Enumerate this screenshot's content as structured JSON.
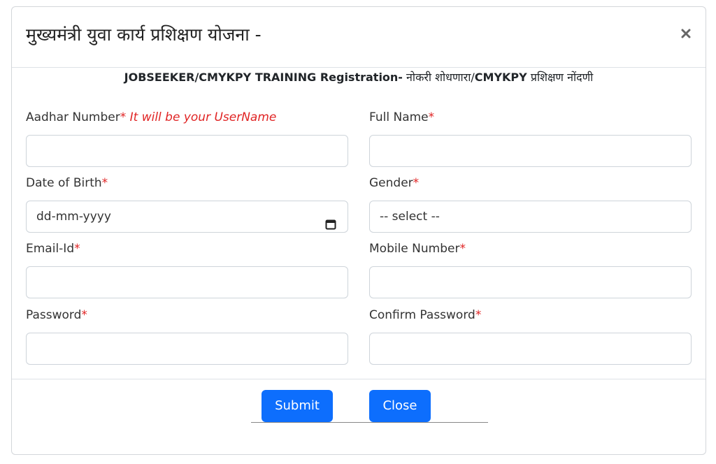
{
  "modal": {
    "title": "मुख्यमंत्री युवा कार्य प्रशिक्षण योजना -",
    "close_icon": "close-icon",
    "subtitle_en": "JOBSEEKER/CMYKPY TRAINING Registration-",
    "subtitle_hi_1": " नोकरी शोधणारा/",
    "subtitle_en_2": "CMYKPY",
    "subtitle_hi_2": " प्रशिक्षण नोंदणी"
  },
  "form": {
    "aadhar": {
      "label": "Aadhar Number",
      "required": "*",
      "hint": " It will be your UserName",
      "value": ""
    },
    "full_name": {
      "label": "Full Name",
      "required": "*",
      "value": ""
    },
    "dob": {
      "label": "Date of Birth",
      "required": "*",
      "placeholder": "dd-mm-yyyy",
      "icon": "calendar-icon"
    },
    "gender": {
      "label": "Gender",
      "required": "*",
      "selected": "-- select --"
    },
    "email": {
      "label": "Email-Id",
      "required": "*",
      "value": ""
    },
    "mobile": {
      "label": "Mobile Number",
      "required": "*",
      "value": ""
    },
    "password": {
      "label": "Password",
      "required": "*",
      "value": ""
    },
    "confirm_password": {
      "label": "Confirm Password",
      "required": "*",
      "value": ""
    }
  },
  "footer": {
    "submit_label": "Submit",
    "close_label": "Close"
  },
  "colors": {
    "primary": "#0d6efd",
    "required": "#e02424"
  }
}
